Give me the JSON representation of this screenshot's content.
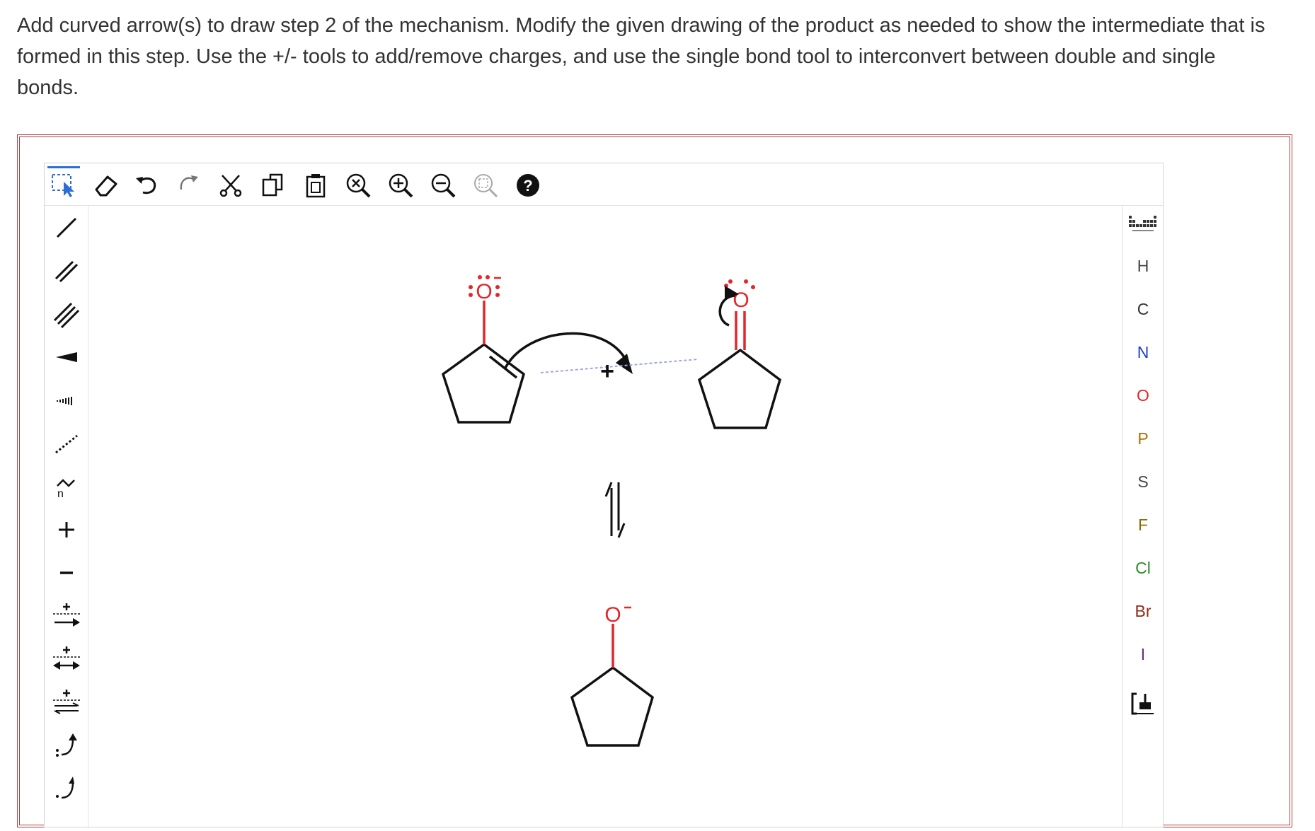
{
  "question": {
    "text": "Add curved arrow(s) to draw step 2 of the mechanism. Modify the given drawing of the product as needed to show the intermediate that is formed in this step. Use the +/- tools to add/remove charges, and use the single bond tool to interconvert between double and single bonds."
  },
  "toolbar": {
    "items": [
      "select-tool",
      "eraser",
      "undo",
      "redo",
      "cut",
      "copy",
      "paste",
      "zoom-reset",
      "zoom-in",
      "zoom-out",
      "zoom-fit",
      "help"
    ]
  },
  "elements": {
    "list": [
      "H",
      "C",
      "N",
      "O",
      "P",
      "S",
      "F",
      "Cl",
      "Br",
      "I"
    ],
    "colors": {
      "H": "#444444",
      "C": "#333333",
      "N": "#1f3fbf",
      "O": "#e4252a",
      "P": "#b36b00",
      "S": "#444444",
      "F": "#8a6d00",
      "Cl": "#2e8b2e",
      "Br": "#8b2d1a",
      "I": "#6b2d8b"
    }
  },
  "canvas": {
    "oxygen_label": "O",
    "plus_label": "+",
    "minus_label": "−"
  },
  "colors": {
    "frame": "#a94442",
    "oxygen": "#e4252a",
    "select_active": "#2b6fd6",
    "dotted_line": "#9fa8da"
  }
}
